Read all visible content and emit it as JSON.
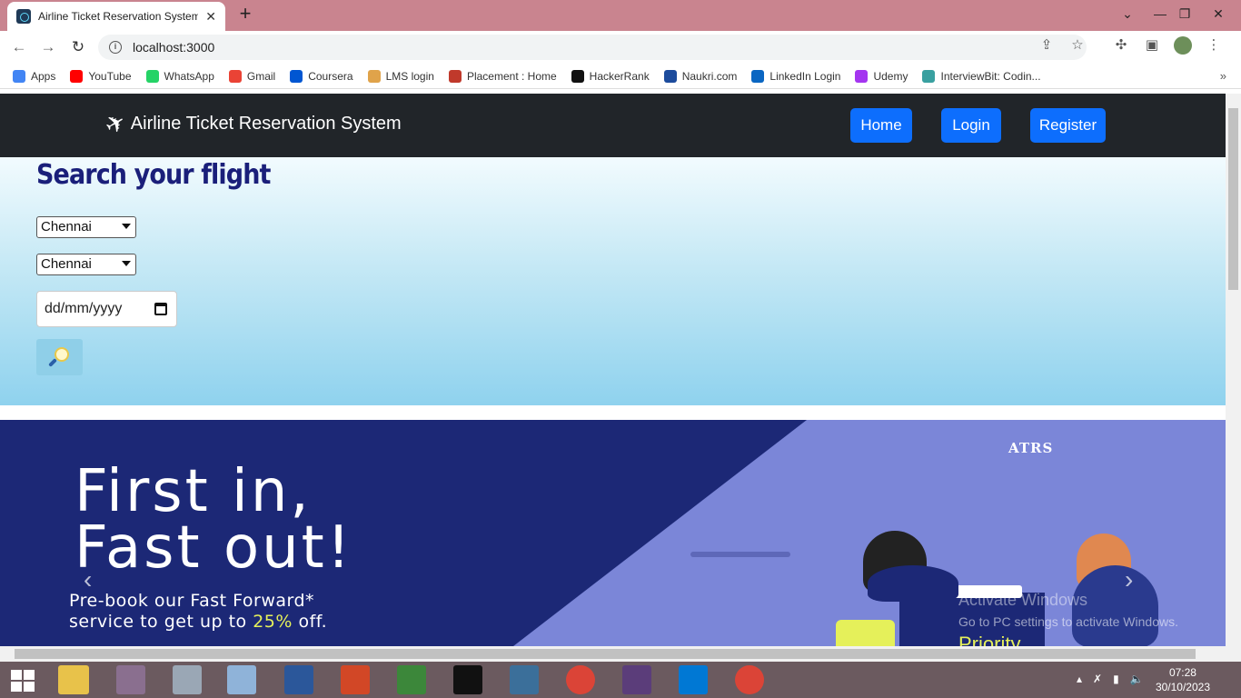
{
  "browser": {
    "tab_title": "Airline Ticket Reservation System",
    "tab_close": "✕",
    "new_tab": "+",
    "url": "localhost:3000",
    "info_icon": "i",
    "window_controls": [
      "⌄",
      "—",
      "❐",
      "✕"
    ]
  },
  "bookmarks": [
    {
      "label": "Apps",
      "color": "#4285f4"
    },
    {
      "label": "YouTube",
      "color": "#ff0000"
    },
    {
      "label": "WhatsApp",
      "color": "#25d366"
    },
    {
      "label": "Gmail",
      "color": "#ea4335"
    },
    {
      "label": "Coursera",
      "color": "#0056d2"
    },
    {
      "label": "LMS login",
      "color": "#e0a34a"
    },
    {
      "label": "Placement : Home",
      "color": "#c0392b"
    },
    {
      "label": "HackerRank",
      "color": "#111111"
    },
    {
      "label": "Naukri.com",
      "color": "#1c4b9c"
    },
    {
      "label": "LinkedIn Login",
      "color": "#0a66c2"
    },
    {
      "label": "Udemy",
      "color": "#a435f0"
    },
    {
      "label": "InterviewBit: Codin...",
      "color": "#39a0a0"
    }
  ],
  "bookmarks_more": "»",
  "app": {
    "brand": "Airline Ticket Reservation System",
    "nav": {
      "home": "Home",
      "login": "Login",
      "register": "Register"
    },
    "search": {
      "heading": "Search your flight",
      "from_value": "Chennai",
      "to_value": "Chennai",
      "date_placeholder": "dd/mm/yyyy"
    },
    "banner": {
      "logo": "ATRS",
      "line1": "First in,",
      "line2": "Fast out!",
      "sub1": "Pre-book our Fast Forward*",
      "sub2_pre": "service to get up to ",
      "sub2_hl": "25%",
      "sub2_post": " off.",
      "activate1": "Activate Windows",
      "activate2": "Go to PC settings to activate Windows.",
      "priority": "Priority",
      "prev": "‹",
      "next": "›"
    }
  },
  "taskbar": {
    "time": "07:28",
    "date": "30/10/2023"
  }
}
